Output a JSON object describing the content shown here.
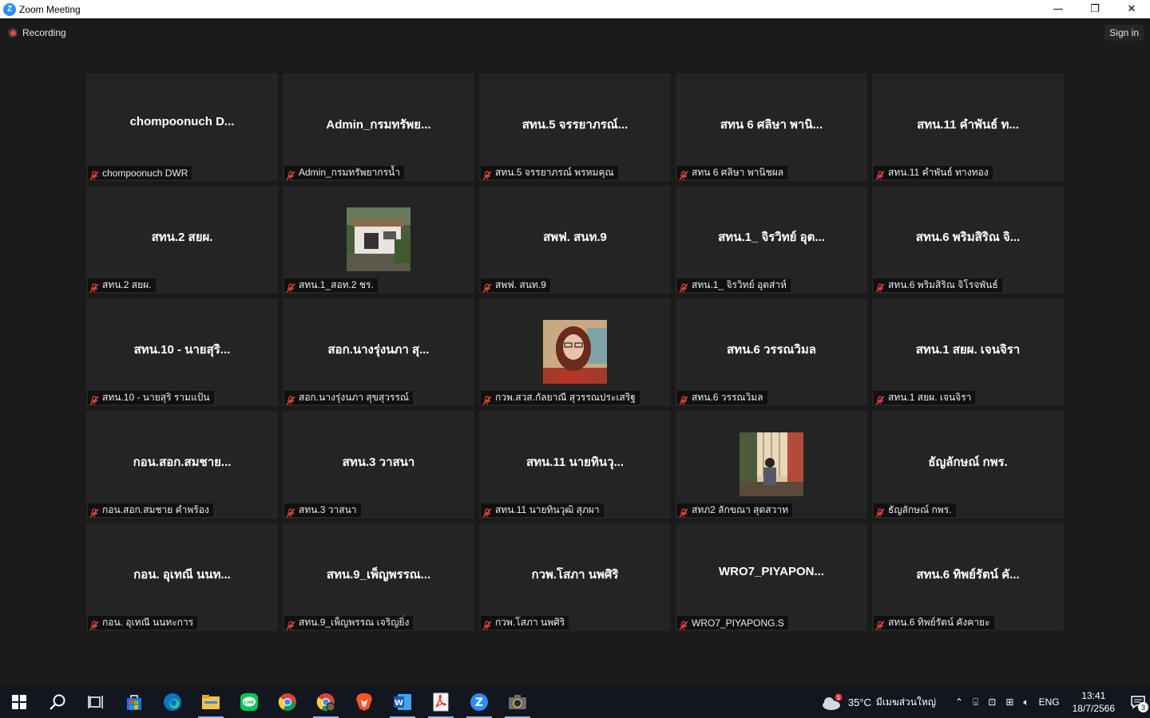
{
  "window": {
    "title": "Zoom Meeting",
    "logo_letter": "Z",
    "minimize": "—",
    "maximize": "❐",
    "close": "✕"
  },
  "meeting": {
    "recording_label": "Recording",
    "signin_label": "Sign in"
  },
  "tiles": [
    {
      "big": "chompoonuch  D...",
      "name": "chompoonuch DWR",
      "photo": ""
    },
    {
      "big": "Admin_กรมทรัพย...",
      "name": "Admin_กรมทรัพยากรน้ำ",
      "photo": ""
    },
    {
      "big": "สทน.5 จรรยาภรณ์...",
      "name": "สทน.5 จรรยาภรณ์ พรหมคุณ",
      "photo": ""
    },
    {
      "big": "สทน 6 ศลิษา พานิ...",
      "name": "สทน 6 ศลิษา พานิชผล",
      "photo": ""
    },
    {
      "big": "สทน.11 คำพันธ์ ท...",
      "name": "สทน.11 คำพันธ์ ทางทอง",
      "photo": ""
    },
    {
      "big": "สทน.2 สยผ.",
      "name": "สทน.2 สยผ.",
      "photo": ""
    },
    {
      "big": "",
      "name": "สทน.1_สอท.2 ชร.",
      "photo": "building"
    },
    {
      "big": "สพฟ. สนท.9",
      "name": "สพฟ. สนท.9",
      "photo": ""
    },
    {
      "big": "สทน.1_ จิรวิทย์ อุต...",
      "name": "สทน.1_ จิรวิทย์ อุตส่าห์",
      "photo": ""
    },
    {
      "big": "สทน.6 พริมสิริณ จิ...",
      "name": "สทน.6 พริมสิริณ จิโรจพันธ์",
      "photo": ""
    },
    {
      "big": "สทน.10 - นายสุริ...",
      "name": "สทน.10 - นายสุริ รามแป้น",
      "photo": ""
    },
    {
      "big": "สอก.นางรุ่งนภา สุ...",
      "name": "สอก.นางรุ่งนภา สุขสุวรรณ์",
      "photo": ""
    },
    {
      "big": "",
      "name": "กวพ.สวส.กัลยาณี สุวรรณประเสริฐ",
      "photo": "woman"
    },
    {
      "big": "สทน.6 วรรณวิมล",
      "name": "สทน.6 วรรณวิมล",
      "photo": ""
    },
    {
      "big": "สทน.1 สยผ. เจนจิรา",
      "name": "สทน.1 สยผ. เจนจิรา",
      "photo": ""
    },
    {
      "big": "กอน.สอก.สมชาย...",
      "name": "กอน.สอก.สมชาย คำพร้อง",
      "photo": ""
    },
    {
      "big": "สทน.3 วาสนา",
      "name": "สทน.3 วาสนา",
      "photo": ""
    },
    {
      "big": "สทน.11 นายทินวุ...",
      "name": "สทน.11 นายทินวุฒิ สุภผา",
      "photo": ""
    },
    {
      "big": "",
      "name": "สทภ2 ลักขณา  สุดสวาท",
      "photo": "room"
    },
    {
      "big": "ธัญลักษณ์ กพร.",
      "name": "ธัญลักษณ์ กพร.",
      "photo": ""
    },
    {
      "big": "กอน. อุเทณี  นนท...",
      "name": "กอน. อุเทณี  นนทะการ",
      "photo": ""
    },
    {
      "big": "สทน.9_เพ็ญพรรณ...",
      "name": "สทน.9_เพ็ญพรรณ เจริญยิ่ง",
      "photo": ""
    },
    {
      "big": "กวพ.โสภา นพศิริ",
      "name": "กวพ.โสภา นพศิริ",
      "photo": ""
    },
    {
      "big": "WRO7_PIYAPON...",
      "name": "WRO7_PIYAPONG.S",
      "photo": ""
    },
    {
      "big": "สทน.6 ทิพย์รัตน์ คั...",
      "name": "สทน.6 ทิพย์รัตน์ คังคายะ",
      "photo": ""
    }
  ],
  "taskbar": {
    "apps": [
      "windows-start",
      "search",
      "task-view",
      "microsoft-store",
      "edge",
      "file-explorer",
      "line",
      "chrome",
      "chrome-profile",
      "brave",
      "word",
      "acrobat",
      "zoom",
      "camera"
    ],
    "weather_temp": "35°C",
    "weather_text": "มีเมฆส่วนใหญ่",
    "weather_badge": "1",
    "lang": "ENG",
    "time": "13:41",
    "date": "18/7/2566",
    "notif_count": "3"
  },
  "colors": {
    "background": "#1a1a1a",
    "tile": "#242424",
    "mute_red": "#e8473d",
    "zoom_blue": "#2d8cff",
    "taskbar": "#12161f"
  }
}
